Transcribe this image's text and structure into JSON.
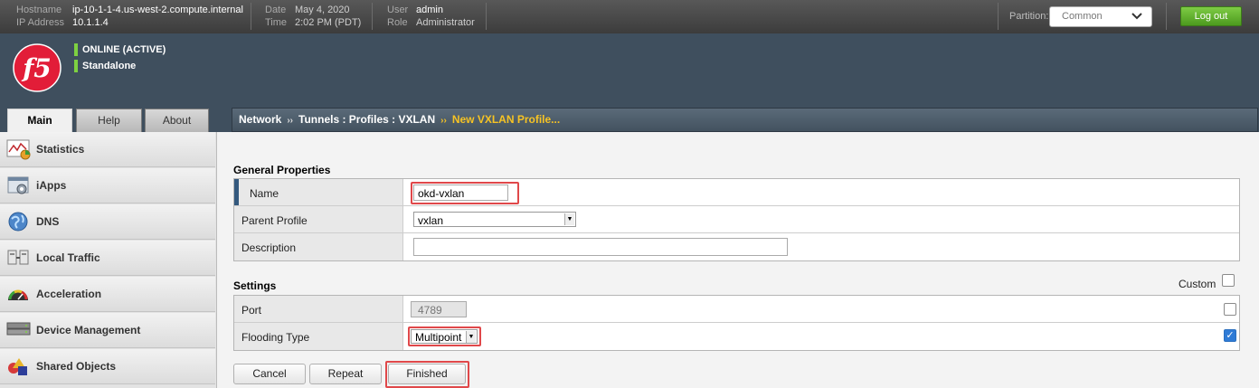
{
  "topbar": {
    "hostname_label": "Hostname",
    "hostname": "ip-10-1-1-4.us-west-2.compute.internal",
    "ip_label": "IP Address",
    "ip": "10.1.1.4",
    "date_label": "Date",
    "date": "May 4, 2020",
    "time_label": "Time",
    "time": "2:02 PM (PDT)",
    "user_label": "User",
    "user": "admin",
    "role_label": "Role",
    "role": "Administrator",
    "partition_label": "Partition:",
    "partition_value": "Common",
    "logout_label": "Log out"
  },
  "status": {
    "line1": "ONLINE (ACTIVE)",
    "line2": "Standalone",
    "indicator_color": "#7ed141"
  },
  "tabs": [
    {
      "label": "Main",
      "active": true
    },
    {
      "label": "Help",
      "active": false
    },
    {
      "label": "About",
      "active": false
    }
  ],
  "breadcrumb": {
    "part1": "Network",
    "part2": "Tunnels : Profiles : VXLAN",
    "current": "New VXLAN Profile...",
    "separator": "››"
  },
  "sidebar": {
    "items": [
      {
        "label": "Statistics",
        "icon": "statistics-icon"
      },
      {
        "label": "iApps",
        "icon": "iapps-icon"
      },
      {
        "label": "DNS",
        "icon": "globe-icon"
      },
      {
        "label": "Local Traffic",
        "icon": "local-traffic-icon"
      },
      {
        "label": "Acceleration",
        "icon": "gauge-icon"
      },
      {
        "label": "Device Management",
        "icon": "device-icon"
      },
      {
        "label": "Shared Objects",
        "icon": "shapes-icon"
      }
    ]
  },
  "general": {
    "title": "General Properties",
    "name_label": "Name",
    "name_value": "okd-vxlan",
    "parent_label": "Parent Profile",
    "parent_value": "vxlan",
    "description_label": "Description",
    "description_value": ""
  },
  "settings": {
    "title": "Settings",
    "custom_label": "Custom",
    "port_label": "Port",
    "port_value": "4789",
    "flooding_label": "Flooding Type",
    "flooding_value": "Multipoint",
    "flooding_custom_checked": true,
    "port_custom_checked": false
  },
  "buttons": {
    "cancel": "Cancel",
    "repeat": "Repeat",
    "finished": "Finished"
  },
  "colors": {
    "highlight": "#e0484a",
    "breadcrumb_current": "#f6c324",
    "logout_green": "#5fae2c",
    "checkbox_blue": "#2f7bd6"
  }
}
